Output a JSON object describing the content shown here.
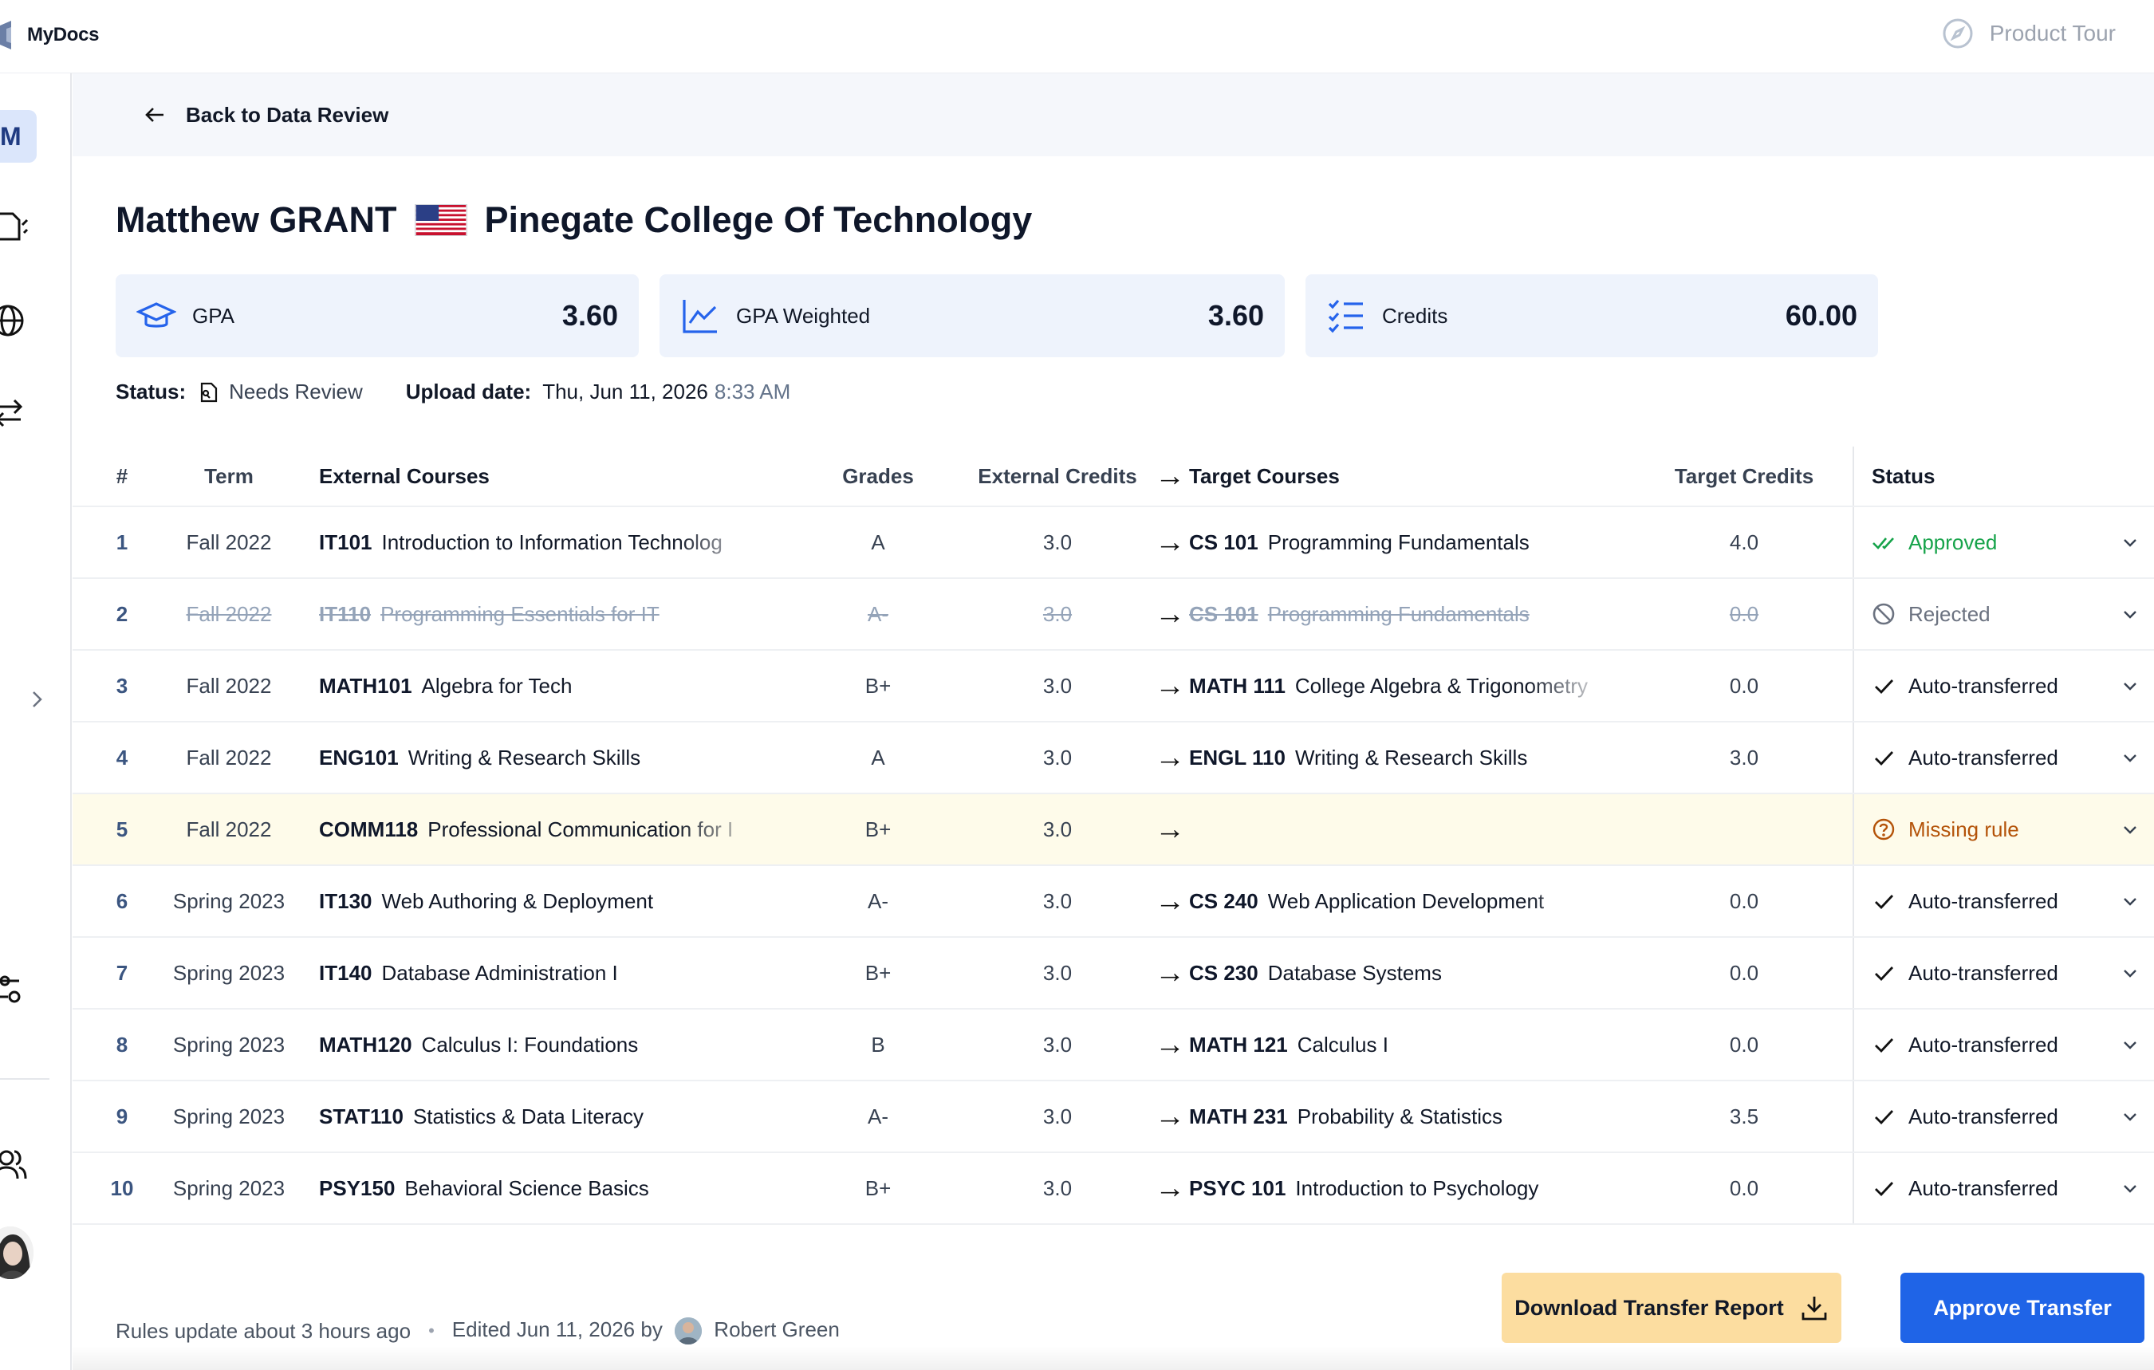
{
  "app": {
    "name": "MyDocs"
  },
  "topbar": {
    "product_tour": "Product Tour"
  },
  "sidebar": {
    "avatar_initial": "M"
  },
  "back": {
    "label": "Back to Data Review"
  },
  "header": {
    "student": "Matthew GRANT",
    "college": "Pinegate College Of Technology"
  },
  "stats": [
    {
      "label": "GPA",
      "value": "3.60",
      "icon": "graduation-cap-icon"
    },
    {
      "label": "GPA Weighted",
      "value": "3.60",
      "icon": "line-chart-icon"
    },
    {
      "label": "Credits",
      "value": "60.00",
      "icon": "checklist-icon"
    }
  ],
  "status": {
    "label": "Status:",
    "value": "Needs Review",
    "upload_label": "Upload date:",
    "upload_date": "Thu, Jun 11, 2026",
    "upload_time": "8:33 AM"
  },
  "table": {
    "headers": {
      "num": "#",
      "term": "Term",
      "external": "External Courses",
      "grades": "Grades",
      "ext_credits": "External Credits",
      "arrow": "→",
      "target": "Target Courses",
      "target_credits": "Target Credits",
      "status": "Status"
    },
    "rows": [
      {
        "num": "1",
        "term": "Fall 2022",
        "ext_code": "IT101",
        "ext_name": "Introduction to Information Technolog",
        "grade": "A",
        "ext_credits": "3.0",
        "tgt_code": "CS 101",
        "tgt_name": "Programming Fundamentals",
        "tgt_credits": "4.0",
        "status": "Approved"
      },
      {
        "num": "2",
        "term": "Fall 2022",
        "ext_code": "IT110",
        "ext_name": "Programming Essentials for IT",
        "grade": "A-",
        "ext_credits": "3.0",
        "tgt_code": "CS 101",
        "tgt_name": "Programming Fundamentals",
        "tgt_credits": "0.0",
        "status": "Rejected"
      },
      {
        "num": "3",
        "term": "Fall 2022",
        "ext_code": "MATH101",
        "ext_name": "Algebra for Tech",
        "grade": "B+",
        "ext_credits": "3.0",
        "tgt_code": "MATH 111",
        "tgt_name": "College Algebra & Trigonometry",
        "tgt_credits": "0.0",
        "status": "Auto-transferred"
      },
      {
        "num": "4",
        "term": "Fall 2022",
        "ext_code": "ENG101",
        "ext_name": "Writing & Research Skills",
        "grade": "A",
        "ext_credits": "3.0",
        "tgt_code": "ENGL 110",
        "tgt_name": "Writing & Research Skills",
        "tgt_credits": "3.0",
        "status": "Auto-transferred"
      },
      {
        "num": "5",
        "term": "Fall 2022",
        "ext_code": "COMM118",
        "ext_name": "Professional Communication for I",
        "grade": "B+",
        "ext_credits": "3.0",
        "tgt_code": "",
        "tgt_name": "",
        "tgt_credits": "",
        "status": "Missing rule"
      },
      {
        "num": "6",
        "term": "Spring 2023",
        "ext_code": "IT130",
        "ext_name": "Web Authoring & Deployment",
        "grade": "A-",
        "ext_credits": "3.0",
        "tgt_code": "CS 240",
        "tgt_name": "Web Application Development",
        "tgt_credits": "0.0",
        "status": "Auto-transferred"
      },
      {
        "num": "7",
        "term": "Spring 2023",
        "ext_code": "IT140",
        "ext_name": "Database Administration I",
        "grade": "B+",
        "ext_credits": "3.0",
        "tgt_code": "CS 230",
        "tgt_name": "Database Systems",
        "tgt_credits": "0.0",
        "status": "Auto-transferred"
      },
      {
        "num": "8",
        "term": "Spring 2023",
        "ext_code": "MATH120",
        "ext_name": "Calculus I: Foundations",
        "grade": "B",
        "ext_credits": "3.0",
        "tgt_code": "MATH 121",
        "tgt_name": "Calculus I",
        "tgt_credits": "0.0",
        "status": "Auto-transferred"
      },
      {
        "num": "9",
        "term": "Spring 2023",
        "ext_code": "STAT110",
        "ext_name": "Statistics & Data Literacy",
        "grade": "A-",
        "ext_credits": "3.0",
        "tgt_code": "MATH 231",
        "tgt_name": "Probability & Statistics",
        "tgt_credits": "3.5",
        "status": "Auto-transferred"
      },
      {
        "num": "10",
        "term": "Spring 2023",
        "ext_code": "PSY150",
        "ext_name": "Behavioral Science Basics",
        "grade": "B+",
        "ext_credits": "3.0",
        "tgt_code": "PSYC 101",
        "tgt_name": "Introduction to Psychology",
        "tgt_credits": "0.0",
        "status": "Auto-transferred"
      }
    ]
  },
  "footer": {
    "rules_update": "Rules update about 3 hours ago",
    "edited": "Edited Jun 11, 2026 by",
    "editor": "Robert Green"
  },
  "actions": {
    "download": "Download Transfer Report",
    "approve": "Approve Transfer"
  },
  "colors": {
    "primary": "#1f64e7",
    "download_bg": "#fcdda0",
    "approved": "#16a34a",
    "missing": "#b45309",
    "stat_bg": "#eef3fc"
  }
}
